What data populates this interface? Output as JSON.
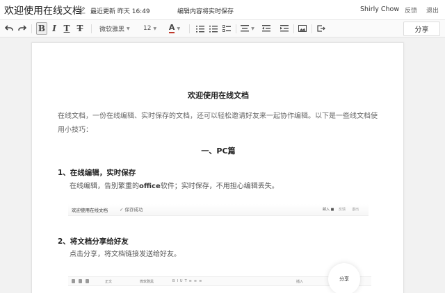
{
  "titlebar": {
    "doc_title": "欢迎使用在线文档",
    "last_update": "最近更新 昨天 16:49",
    "save_status": "编辑内容将实时保存",
    "user_name": "Shirly Chow",
    "feedback": "反馈",
    "exit": "退出"
  },
  "toolbar": {
    "bold": "B",
    "italic": "I",
    "underline": "T",
    "strike": "T",
    "font_family": "微软雅黑",
    "font_size": "12",
    "font_color_glyph": "A",
    "share_label": "分享"
  },
  "document": {
    "title": "欢迎使用在线文档",
    "intro": "在线文档，一份在线编辑、实时保存的文档，还可以轻松邀请好友来一起协作编辑。以下是一些线文档使用小技巧：",
    "section_pc": "一、PC篇",
    "s1_heading": "1、在线编辑，实时保存",
    "s1_pre": "在线编辑，告别繁重的",
    "s1_bold": "office",
    "s1_post": "软件；实时保存，不用担心编辑丢失。",
    "s2_heading": "2、将文档分享给好友",
    "s2_body": "点击分享，将文档链接发送给好友。"
  },
  "thumbnail1": {
    "title": "欢迎使用在线文档",
    "saved": "保存成功",
    "r1": "邮入 ■",
    "r2": "反馈",
    "r3": "退出"
  },
  "thumbnail2": {
    "style": "正文",
    "font": "微软雅黑",
    "insert": "插入",
    "share": "分享"
  },
  "colors": {
    "accent_underline": "#c0392b",
    "page_bg": "#ffffff",
    "canvas_bg": "#f2f2f2"
  }
}
